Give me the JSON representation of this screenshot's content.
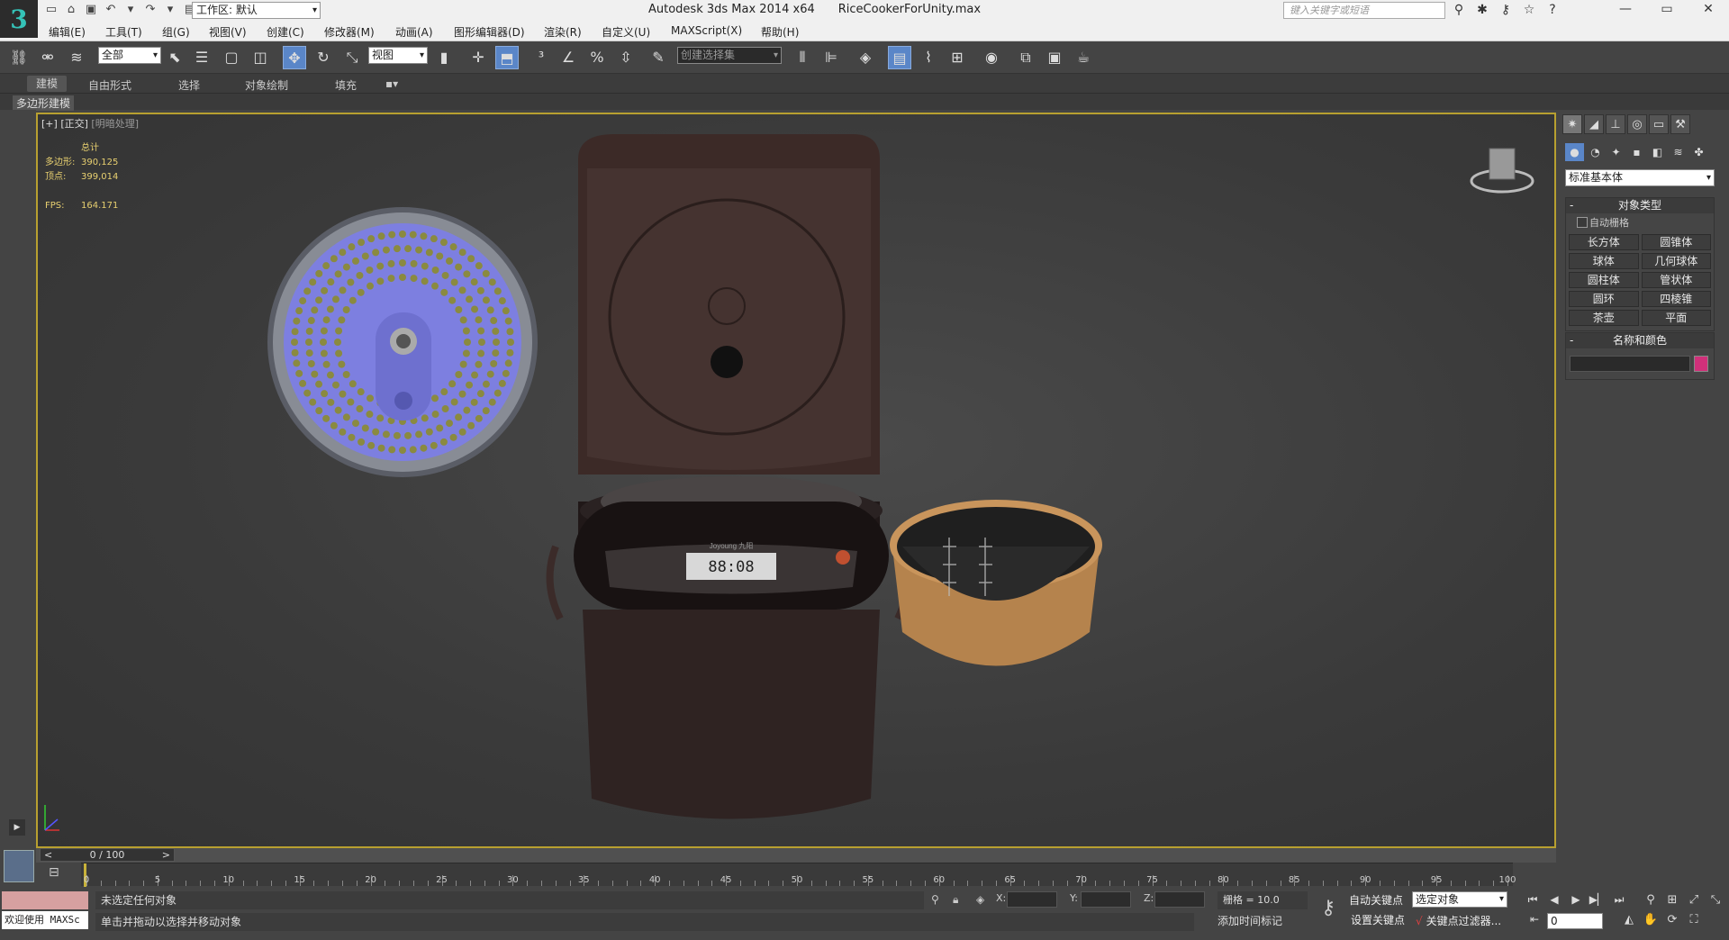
{
  "app": {
    "title": "Autodesk 3ds Max  2014 x64",
    "file": "RiceCookerForUnity.max",
    "workspace": "工作区: 默认",
    "search_placeholder": "键入关键字或短语",
    "logo_glyph": "3"
  },
  "menu": [
    "编辑(E)",
    "工具(T)",
    "组(G)",
    "视图(V)",
    "创建(C)",
    "修改器(M)",
    "动画(A)",
    "图形编辑器(D)",
    "渲染(R)",
    "自定义(U)",
    "MAXScript(X)",
    "帮助(H)"
  ],
  "toolbar": {
    "filter": "全部",
    "ref_coord": "视图",
    "named_selection": "创建选择集"
  },
  "ribbon": {
    "tabs": [
      "建模",
      "自由形式",
      "选择",
      "对象绘制",
      "填充"
    ],
    "active_tab": "建模",
    "sub_tab": "多边形建模"
  },
  "viewport": {
    "label_plus": "[+]",
    "label_view": "[正交]",
    "label_shading": "[明暗处理]",
    "stats_header": "总计",
    "polys_label": "多边形:",
    "polys": "390,125",
    "verts_label": "顶点:",
    "verts": "399,014",
    "fps_label": "FPS:",
    "fps": "164.171",
    "display_label": "88:08",
    "brand_text": "Joyoung 九阳"
  },
  "command_panel": {
    "category": "标准基本体",
    "object_type_title": "对象类型",
    "autogrid": "自动栅格",
    "primitives": [
      "长方体",
      "圆锥体",
      "球体",
      "几何球体",
      "圆柱体",
      "管状体",
      "圆环",
      "四棱锥",
      "茶壶",
      "平面"
    ],
    "name_color_title": "名称和颜色",
    "object_color": "#d0307a"
  },
  "timeline": {
    "slider": "0 / 100",
    "ticks": [
      "0",
      "5",
      "10",
      "15",
      "20",
      "25",
      "30",
      "35",
      "40",
      "45",
      "50",
      "55",
      "60",
      "65",
      "70",
      "75",
      "80",
      "85",
      "90",
      "95",
      "100"
    ]
  },
  "status": {
    "maxscript": "欢迎使用 MAXSc",
    "line1": "未选定任何对象",
    "line2": "单击并拖动以选择并移动对象",
    "x_label": "X:",
    "y_label": "Y:",
    "z_label": "Z:",
    "grid": "栅格 = 10.0",
    "add_time_tag": "添加时间标记",
    "auto_key": "自动关键点",
    "set_key": "设置关键点",
    "selected": "选定对象",
    "key_filters": "关键点过滤器...",
    "frame": "0"
  }
}
